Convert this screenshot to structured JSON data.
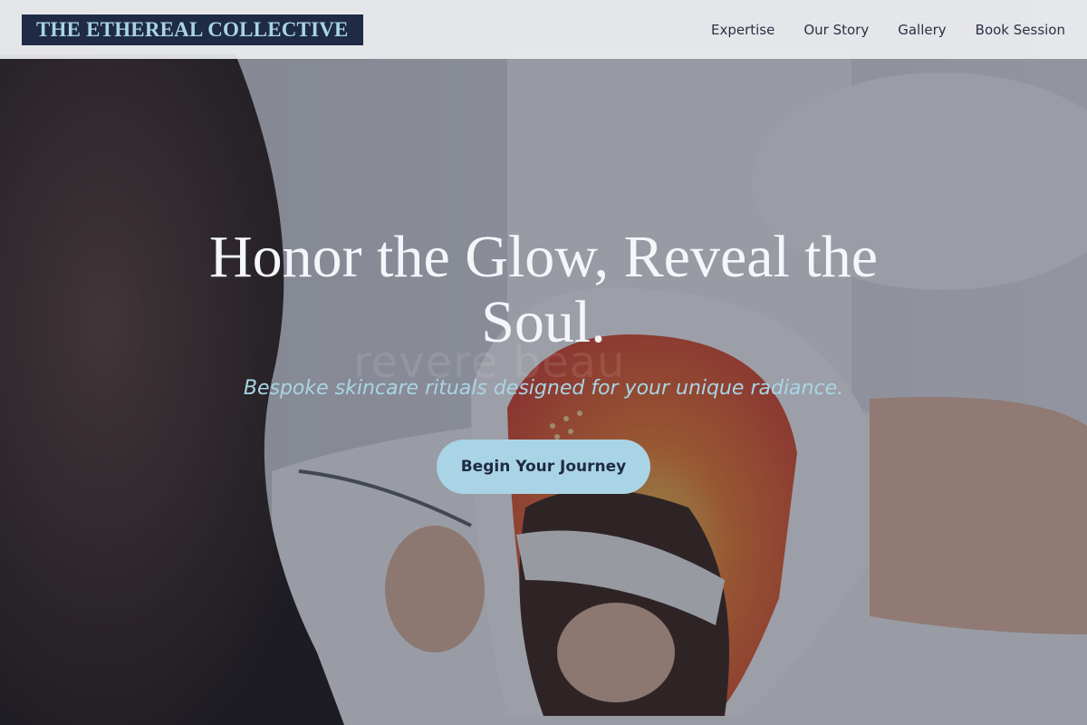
{
  "navbar": {
    "logo": "THE ETHEREAL COLLECTIVE",
    "links": [
      {
        "label": "Expertise"
      },
      {
        "label": "Our Story"
      },
      {
        "label": "Gallery"
      },
      {
        "label": "Book Session"
      }
    ]
  },
  "hero": {
    "title": "Honor the Glow, Reveal the Soul.",
    "subtitle": "Bespoke skincare rituals designed for your unique radiance.",
    "cta_label": "Begin Your Journey",
    "watermark": "revere beau"
  },
  "colors": {
    "navy": "#1f2a44",
    "accent": "#a9d4e6",
    "title": "#f4f6fa"
  }
}
